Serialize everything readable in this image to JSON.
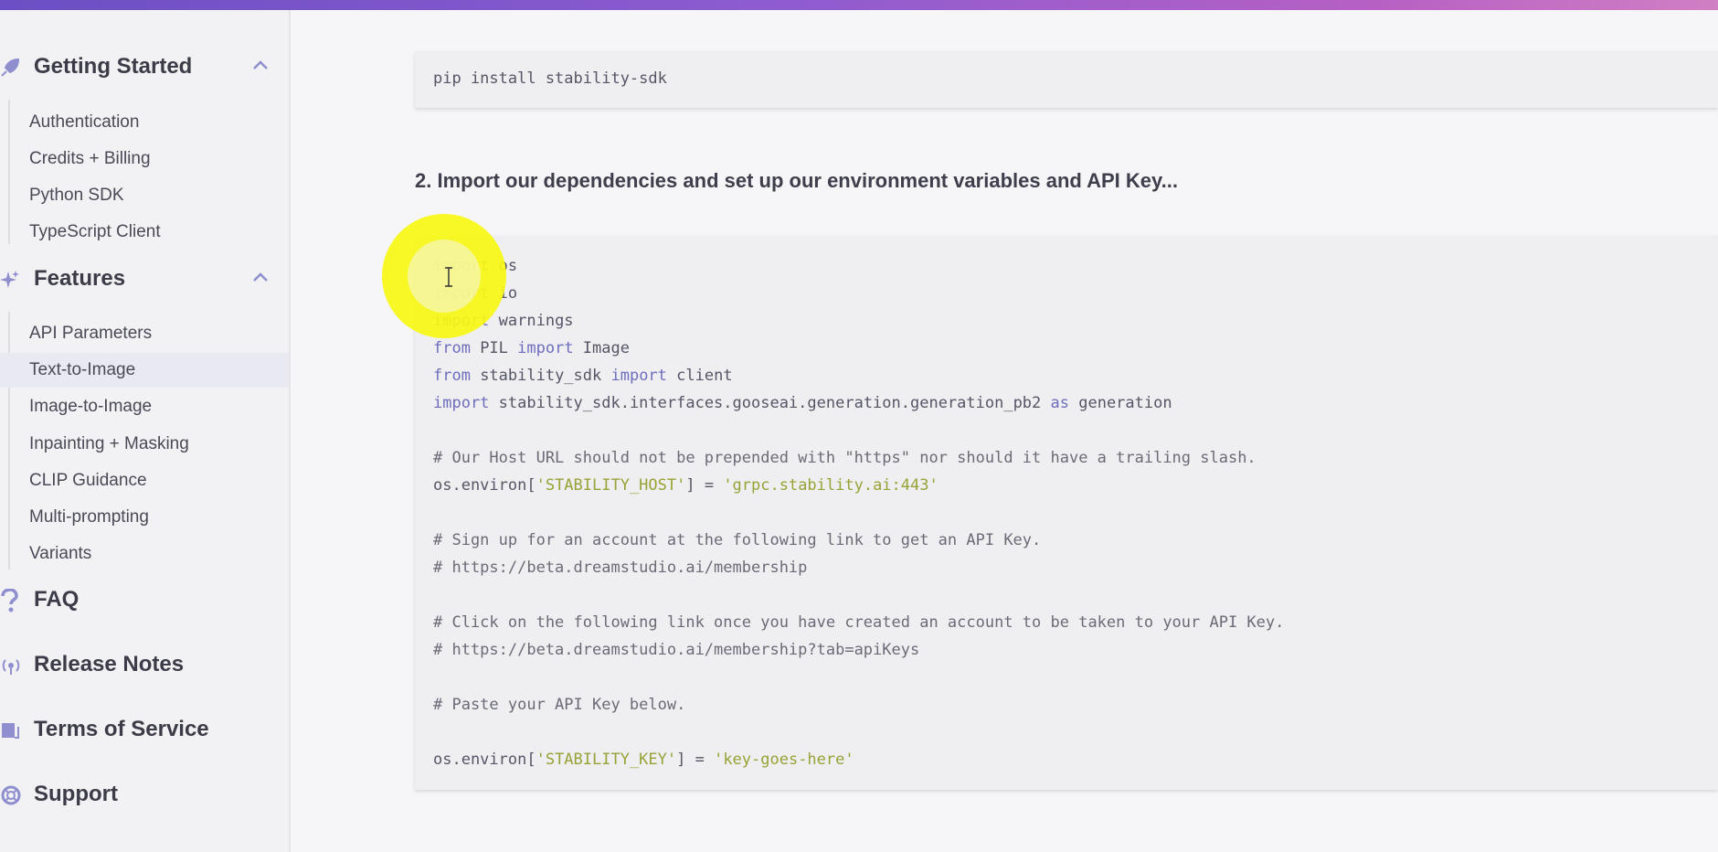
{
  "sidebar": {
    "sections": [
      {
        "label": "Getting Started",
        "icon": "rocket-icon",
        "expanded": true,
        "items": [
          "Authentication",
          "Credits + Billing",
          "Python SDK",
          "TypeScript Client"
        ]
      },
      {
        "label": "Features",
        "icon": "sparkle-icon",
        "expanded": true,
        "items": [
          "API Parameters",
          "Text-to-Image",
          "Image-to-Image",
          "Inpainting + Masking",
          "CLIP Guidance",
          "Multi-prompting",
          "Variants"
        ]
      },
      {
        "label": "FAQ",
        "icon": "question-icon"
      },
      {
        "label": "Release Notes",
        "icon": "broadcast-icon"
      },
      {
        "label": "Terms of Service",
        "icon": "book-icon"
      },
      {
        "label": "Support",
        "icon": "lifebuoy-icon"
      }
    ],
    "active_item": "Text-to-Image"
  },
  "content": {
    "install_command": "pip install stability-sdk",
    "step2_heading": "2. Import our dependencies and set up our environment variables and API Key...",
    "code": {
      "l1_kw": "import",
      "l1_rest": " os",
      "l2_kw": "import",
      "l2_rest": " io",
      "l3_kw": "import",
      "l3_rest": " warnings",
      "l4_kw1": "from",
      "l4_mid": " PIL ",
      "l4_kw2": "import",
      "l4_rest": " Image",
      "l5_kw1": "from",
      "l5_mid": " stability_sdk ",
      "l5_kw2": "import",
      "l5_rest": " client",
      "l6_kw1": "import",
      "l6_mid": " stability_sdk.interfaces.gooseai.generation.generation_pb2 ",
      "l6_kw2": "as",
      "l6_rest": " generation",
      "c1": "# Our Host URL should not be prepended with \"https\" nor should it have a trailing slash.",
      "l8_pre": "os.environ[",
      "l8_key": "'STABILITY_HOST'",
      "l8_mid": "] = ",
      "l8_val": "'grpc.stability.ai:443'",
      "c2": "# Sign up for an account at the following link to get an API Key.",
      "c3": "# https://beta.dreamstudio.ai/membership",
      "c4": "# Click on the following link once you have created an account to be taken to your API Key.",
      "c5": "# https://beta.dreamstudio.ai/membership?tab=apiKeys",
      "c6": "# Paste your API Key below.",
      "l14_pre": "os.environ[",
      "l14_key": "'STABILITY_KEY'",
      "l14_mid": "] = ",
      "l14_val": "'key-goes-here'"
    }
  },
  "colors": {
    "accent_gradient_start": "#6b4fc4",
    "accent_gradient_end": "#d07fc4",
    "keyword": "#6d6dbd",
    "string": "#98a236",
    "highlight": "#f7f714"
  }
}
